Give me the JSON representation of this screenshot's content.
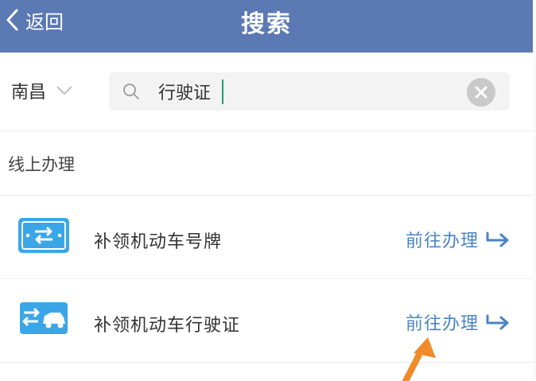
{
  "header": {
    "back_label": "返回",
    "title": "搜索",
    "color": "#5b79b3"
  },
  "search": {
    "city": "南昌",
    "query": "行驶证",
    "caret_color": "#1e9e72"
  },
  "section": {
    "title": "线上办理"
  },
  "results": [
    {
      "label": "补领机动车号牌",
      "action": "前往办理",
      "icon": "license-plate-icon"
    },
    {
      "label": "补领机动车行驶证",
      "action": "前往办理",
      "icon": "car-transfer-icon"
    }
  ],
  "accent_color": "#4b83c4",
  "annotation_color": "#f08a2a"
}
